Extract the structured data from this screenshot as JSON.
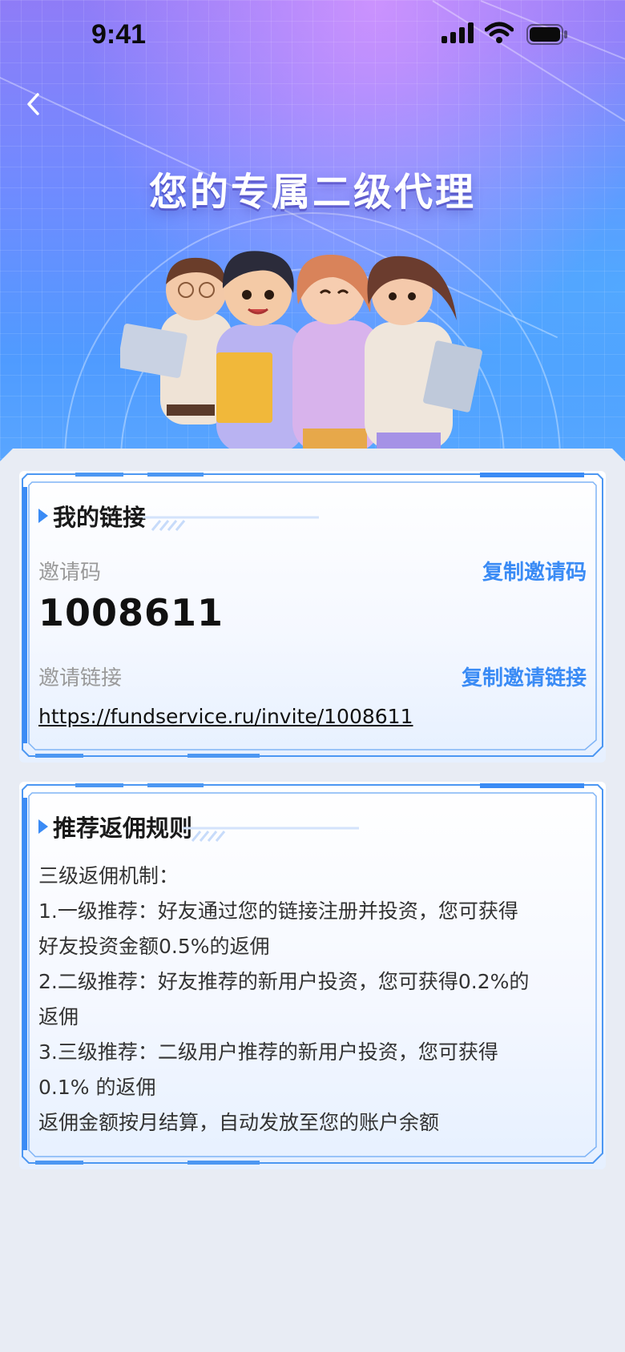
{
  "status_bar": {
    "time": "9:41"
  },
  "header": {
    "title": "您的专属二级代理"
  },
  "my_link": {
    "title": "我的链接",
    "invite_code_label": "邀请码",
    "copy_code_label": "复制邀请码",
    "invite_code": "1008611",
    "invite_link_label": "邀请链接",
    "copy_link_label": "复制邀请链接",
    "invite_link": "https://fundservice.ru/invite/1008611"
  },
  "rules": {
    "title": "推荐返佣规则",
    "lines": [
      "三级返佣机制：",
      "1.一级推荐：好友通过您的链接注册并投资，您可获得",
      "好友投资金额0.5%的返佣",
      "2.二级推荐：好友推荐的新用户投资，您可获得0.2%的",
      "返佣",
      "3.三级推荐：二级用户推荐的新用户投资，您可获得",
      "0.1% 的返佣",
      "返佣金额按月结算，自动发放至您的账户余额"
    ]
  },
  "colors": {
    "accent": "#3a8bf5",
    "hero_top": "#8f7cf7",
    "hero_bottom": "#5ba8ff",
    "page_bg": "#e8ecf4"
  },
  "icons": {
    "back": "chevron-left-icon",
    "signal": "signal-icon",
    "wifi": "wifi-icon",
    "battery": "battery-icon"
  }
}
